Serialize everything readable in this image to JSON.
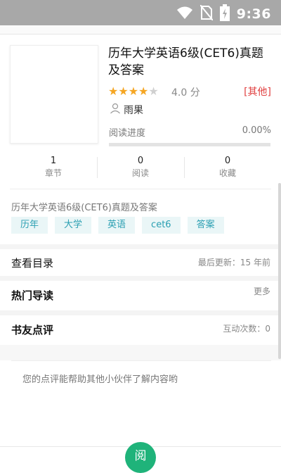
{
  "status_bar": {
    "time": "9:36",
    "icons": [
      "wifi-icon",
      "no-sim-icon",
      "battery-charging-icon"
    ]
  },
  "book": {
    "title": "历年大学英语6级(CET6)真题及答案",
    "rating_stars": 4,
    "rating_max": 5,
    "score": "4.0 分",
    "category": "[其他]",
    "author": "雨果",
    "progress_label": "阅读进度",
    "progress_value": "0.00%",
    "progress_fraction": 0.0
  },
  "stats": [
    {
      "num": "1",
      "label": "章节"
    },
    {
      "num": "0",
      "label": "阅读"
    },
    {
      "num": "0",
      "label": "收藏"
    }
  ],
  "description": "历年大学英语6级(CET6)真题及答案",
  "tags": [
    "历年",
    "大学",
    "英语",
    "cet6",
    "答案"
  ],
  "toc": {
    "title": "查看目录",
    "updated": "最后更新：15 年前"
  },
  "hot": {
    "title": "热门导读",
    "more": "更多"
  },
  "reviews": {
    "title": "书友点评",
    "count": "互动次数：0",
    "hint": "您的点评能帮助其他小伙伴了解内容哟"
  },
  "bottom": {
    "read_label": "阅"
  },
  "colors": {
    "accent": "#1fb37a",
    "tag_bg": "#eaf6f7",
    "tag_text": "#2a9fb2",
    "category": "#e04040",
    "star": "#f5a623"
  }
}
